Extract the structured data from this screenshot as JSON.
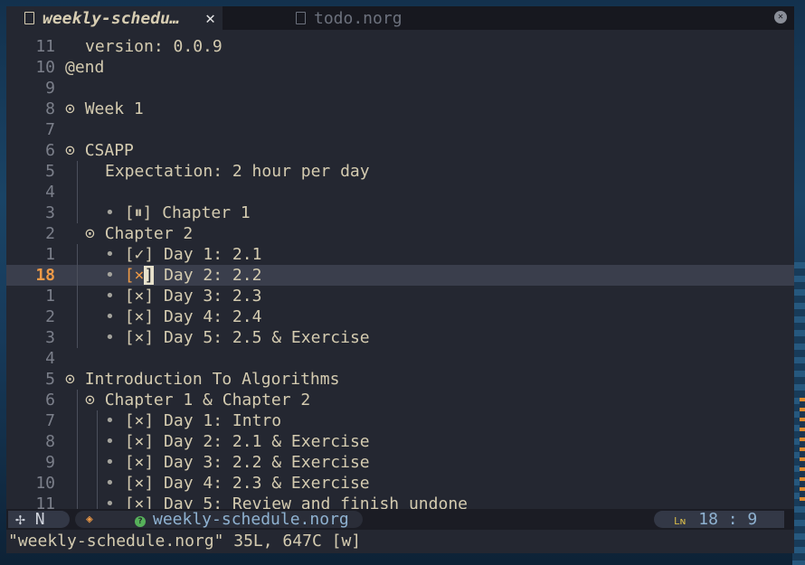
{
  "tabs": [
    {
      "name": "weekly-schedu…",
      "close": "✕",
      "active": true
    },
    {
      "name": "todo.norg",
      "active": false
    }
  ],
  "tab_close_all": "✕",
  "lines": [
    {
      "n": "11",
      "indent": 1,
      "text": "version: 0.0.9"
    },
    {
      "n": "10",
      "indent": 0,
      "text": "@end"
    },
    {
      "n": "9",
      "indent": 0,
      "text": ""
    },
    {
      "n": "8",
      "indent": 0,
      "heading": "⊙",
      "text": "Week 1"
    },
    {
      "n": "7",
      "indent": 0,
      "text": ""
    },
    {
      "n": "6",
      "indent": 0,
      "heading": "⊙",
      "text": "CSAPP"
    },
    {
      "n": "5",
      "indent": 2,
      "guides": [
        1
      ],
      "text": "Expectation: 2 hour per day"
    },
    {
      "n": "4",
      "indent": 0,
      "guides": [
        1
      ],
      "text": ""
    },
    {
      "n": "3",
      "indent": 2,
      "guides": [
        1
      ],
      "bullet": "•",
      "box": "[⏸]",
      "text": "Chapter 1"
    },
    {
      "n": "2",
      "indent": 1,
      "heading": "⊙",
      "text": "Chapter 2"
    },
    {
      "n": "1",
      "indent": 2,
      "guides": [
        1
      ],
      "bullet": "•",
      "box": "[✓]",
      "text": "Day 1: 2.1"
    },
    {
      "n": "18",
      "indent": 2,
      "guides": [
        1
      ],
      "bullet": "•",
      "box": "[×]",
      "text": "Day 2: 2.2",
      "current": true
    },
    {
      "n": "1",
      "indent": 2,
      "guides": [
        1
      ],
      "bullet": "•",
      "box": "[×]",
      "text": "Day 3: 2.3"
    },
    {
      "n": "2",
      "indent": 2,
      "guides": [
        1
      ],
      "bullet": "•",
      "box": "[×]",
      "text": "Day 4: 2.4"
    },
    {
      "n": "3",
      "indent": 2,
      "guides": [
        1
      ],
      "bullet": "•",
      "box": "[×]",
      "text": "Day 5: 2.5 & Exercise"
    },
    {
      "n": "4",
      "indent": 0,
      "text": ""
    },
    {
      "n": "5",
      "indent": 0,
      "heading": "⊙",
      "text": "Introduction To Algorithms"
    },
    {
      "n": "6",
      "indent": 1,
      "guides": [
        1
      ],
      "heading": "⊙",
      "text": "Chapter 1 & Chapter 2"
    },
    {
      "n": "7",
      "indent": 2,
      "guides": [
        1,
        2
      ],
      "bullet": "•",
      "box": "[×]",
      "text": "Day 1: Intro"
    },
    {
      "n": "8",
      "indent": 2,
      "guides": [
        1,
        2
      ],
      "bullet": "•",
      "box": "[×]",
      "text": "Day 2: 2.1 & Exercise"
    },
    {
      "n": "9",
      "indent": 2,
      "guides": [
        1,
        2
      ],
      "bullet": "•",
      "box": "[×]",
      "text": "Day 3: 2.2 & Exercise"
    },
    {
      "n": "10",
      "indent": 2,
      "guides": [
        1,
        2
      ],
      "bullet": "•",
      "box": "[×]",
      "text": "Day 4: 2.3 & Exercise"
    },
    {
      "n": "11",
      "indent": 2,
      "guides": [
        1,
        2
      ],
      "bullet": "•",
      "box": "[×]",
      "text": "Day 5: Review and finish undone"
    }
  ],
  "statusline": {
    "mode_icon": "✢",
    "mode": "N",
    "git_icon": "◈",
    "file_status_icon": "?",
    "filename": "weekly-schedule.norg",
    "ln_icon": "Lɴ",
    "position": "18 : 9"
  },
  "cmdline": "\"weekly-schedule.norg\" 35L, 647C [w]",
  "colors": {
    "accent": "#ee9a47",
    "background": "#242731",
    "text": "#d4cbb0",
    "statusline_file": "#8fb2d1"
  }
}
